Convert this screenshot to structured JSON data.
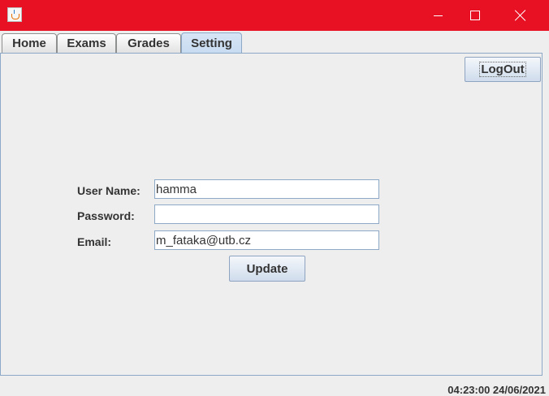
{
  "window": {
    "icon": "java-cup-icon",
    "title_bar_color": "#e81123",
    "controls": [
      "minimize-icon",
      "maximize-icon",
      "close-icon"
    ]
  },
  "tabs": [
    {
      "label": "Home"
    },
    {
      "label": "Exams"
    },
    {
      "label": "Grades"
    },
    {
      "label": "Setting",
      "active": true
    }
  ],
  "toolbar": {
    "logout_label": "LogOut"
  },
  "form": {
    "username_label": "User Name:",
    "username_value": "hamma",
    "password_label": "Password:",
    "password_value": "",
    "email_label": "Email:",
    "email_value": "m_fataka@utb.cz",
    "update_label": "Update"
  },
  "status": {
    "datetime": "04:23:00 24/06/2021"
  }
}
